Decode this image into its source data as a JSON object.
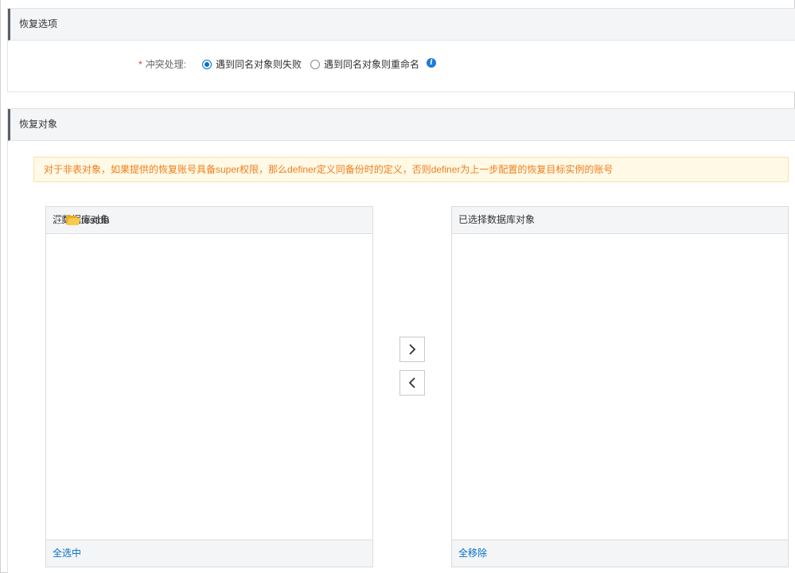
{
  "options_section": {
    "title": "恢复选项",
    "conflict": {
      "required_mark": "*",
      "label": "冲突处理:",
      "options": [
        {
          "label": "遇到同名对象则失败",
          "checked": true
        },
        {
          "label": "遇到同名对象则重命名",
          "checked": false
        }
      ],
      "info_icon": "info-icon"
    }
  },
  "objects_section": {
    "title": "恢复对象",
    "notice": "对于非表对象，如果提供的恢复账号具备super权限，那么definer定义同备份时的定义，否则definer为上一步配置的恢复目标实例的账号",
    "source_panel": {
      "title": "源数据库对象",
      "tree": [
        {
          "label": "testdb",
          "icon": "folder-open-icon",
          "expanded": false
        }
      ],
      "footer_link": "全选中"
    },
    "move_buttons": {
      "right_icon": "chevron-right-icon",
      "left_icon": "chevron-left-icon"
    },
    "selected_panel": {
      "title": "已选择数据库对象",
      "footer_link": "全移除"
    }
  },
  "colors": {
    "accent": "#0070cc",
    "required": "#e4393c",
    "notice_text": "#f07e1c",
    "notice_bg": "#fff9e6",
    "header_bg": "#f4f5f7"
  }
}
